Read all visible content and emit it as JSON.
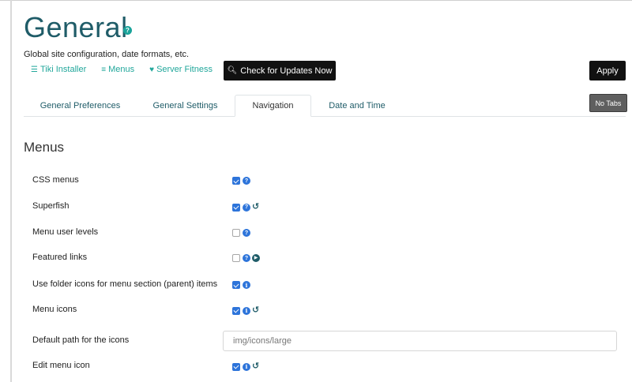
{
  "page": {
    "title": "General",
    "subtitle": "Global site configuration, date formats, etc."
  },
  "toplinks": [
    {
      "label": "Tiki Installer",
      "icon": "database-icon"
    },
    {
      "label": "Menus",
      "icon": "bars-icon"
    },
    {
      "label": "Server Fitness",
      "icon": "heartbeat-icon"
    }
  ],
  "buttons": {
    "updates": "Check for Updates Now",
    "apply": "Apply",
    "notabs": "No Tabs"
  },
  "tabs": [
    {
      "label": "General Preferences",
      "active": false
    },
    {
      "label": "General Settings",
      "active": false
    },
    {
      "label": "Navigation",
      "active": true
    },
    {
      "label": "Date and Time",
      "active": false
    }
  ],
  "section": {
    "title": "Menus"
  },
  "settings": [
    {
      "label": "CSS menus",
      "checked": true
    },
    {
      "label": "Superfish",
      "checked": true
    },
    {
      "label": "Menu user levels",
      "checked": false
    },
    {
      "label": "Featured links",
      "checked": false
    },
    {
      "label": "Use folder icons for menu section (parent) items",
      "checked": true
    },
    {
      "label": "Menu icons",
      "checked": true
    },
    {
      "label": "Default path for the icons",
      "value": "img/icons/large"
    },
    {
      "label": "Edit menu icon",
      "checked": true
    }
  ],
  "colors": {
    "accent_teal": "#21a79b",
    "title": "#1f5c68",
    "checkbox_blue": "#2d74da"
  }
}
